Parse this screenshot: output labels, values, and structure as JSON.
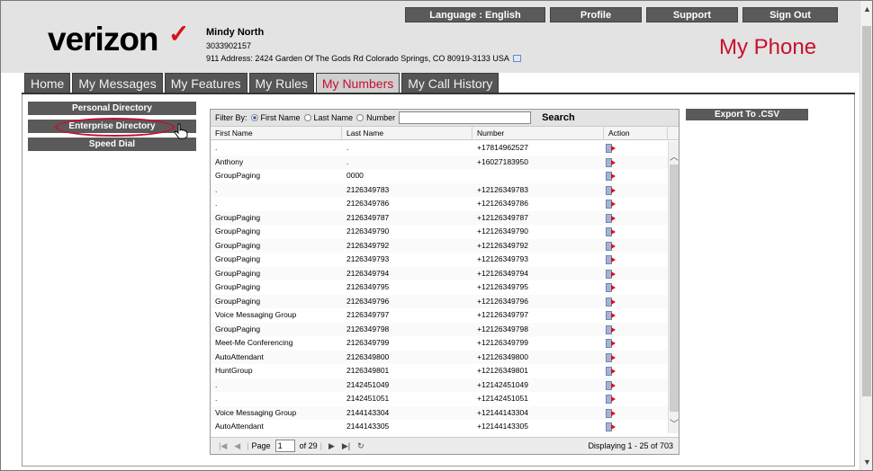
{
  "header": {
    "logo_text": "verizon",
    "logo_mark": "✓",
    "user_name": "Mindy North",
    "user_phone": "3033902157",
    "user_address": "911 Address: 2424 Garden Of The Gods Rd Colorado Springs, CO 80919-3133 USA",
    "app_title": "My Phone",
    "top_buttons": [
      "Language : English",
      "Profile",
      "Support",
      "Sign Out"
    ]
  },
  "tabs": [
    "Home",
    "My Messages",
    "My Features",
    "My Rules",
    "My Numbers",
    "My Call History"
  ],
  "active_tab": "My Numbers",
  "left_menu": [
    "Personal Directory",
    "Enterprise Directory",
    "Speed Dial"
  ],
  "filter": {
    "label": "Filter By:",
    "options": [
      "First Name",
      "Last Name",
      "Number"
    ],
    "selected": "First Name",
    "search_value": "",
    "search_label": "Search"
  },
  "columns": [
    "First Name",
    "Last Name",
    "Number",
    "Action"
  ],
  "rows": [
    [
      ".",
      ".",
      "+17814962527"
    ],
    [
      "Anthony",
      ".",
      "+16027183950"
    ],
    [
      "GroupPaging",
      "0000",
      ""
    ],
    [
      ".",
      "2126349783",
      "+12126349783"
    ],
    [
      ".",
      "2126349786",
      "+12126349786"
    ],
    [
      "GroupPaging",
      "2126349787",
      "+12126349787"
    ],
    [
      "GroupPaging",
      "2126349790",
      "+12126349790"
    ],
    [
      "GroupPaging",
      "2126349792",
      "+12126349792"
    ],
    [
      "GroupPaging",
      "2126349793",
      "+12126349793"
    ],
    [
      "GroupPaging",
      "2126349794",
      "+12126349794"
    ],
    [
      "GroupPaging",
      "2126349795",
      "+12126349795"
    ],
    [
      "GroupPaging",
      "2126349796",
      "+12126349796"
    ],
    [
      "Voice Messaging Group",
      "2126349797",
      "+12126349797"
    ],
    [
      "GroupPaging",
      "2126349798",
      "+12126349798"
    ],
    [
      "Meet-Me Conferencing",
      "2126349799",
      "+12126349799"
    ],
    [
      "AutoAttendant",
      "2126349800",
      "+12126349800"
    ],
    [
      "HuntGroup",
      "2126349801",
      "+12126349801"
    ],
    [
      ".",
      "2142451049",
      "+12142451049"
    ],
    [
      ".",
      "2142451051",
      "+12142451051"
    ],
    [
      "Voice Messaging Group",
      "2144143304",
      "+12144143304"
    ],
    [
      "AutoAttendant",
      "2144143305",
      "+12144143305"
    ]
  ],
  "pager": {
    "page_label": "Page",
    "page_value": "1",
    "of_label": "of 29",
    "displaying": "Displaying 1 - 25 of 703"
  },
  "export_label": "Export To .CSV"
}
